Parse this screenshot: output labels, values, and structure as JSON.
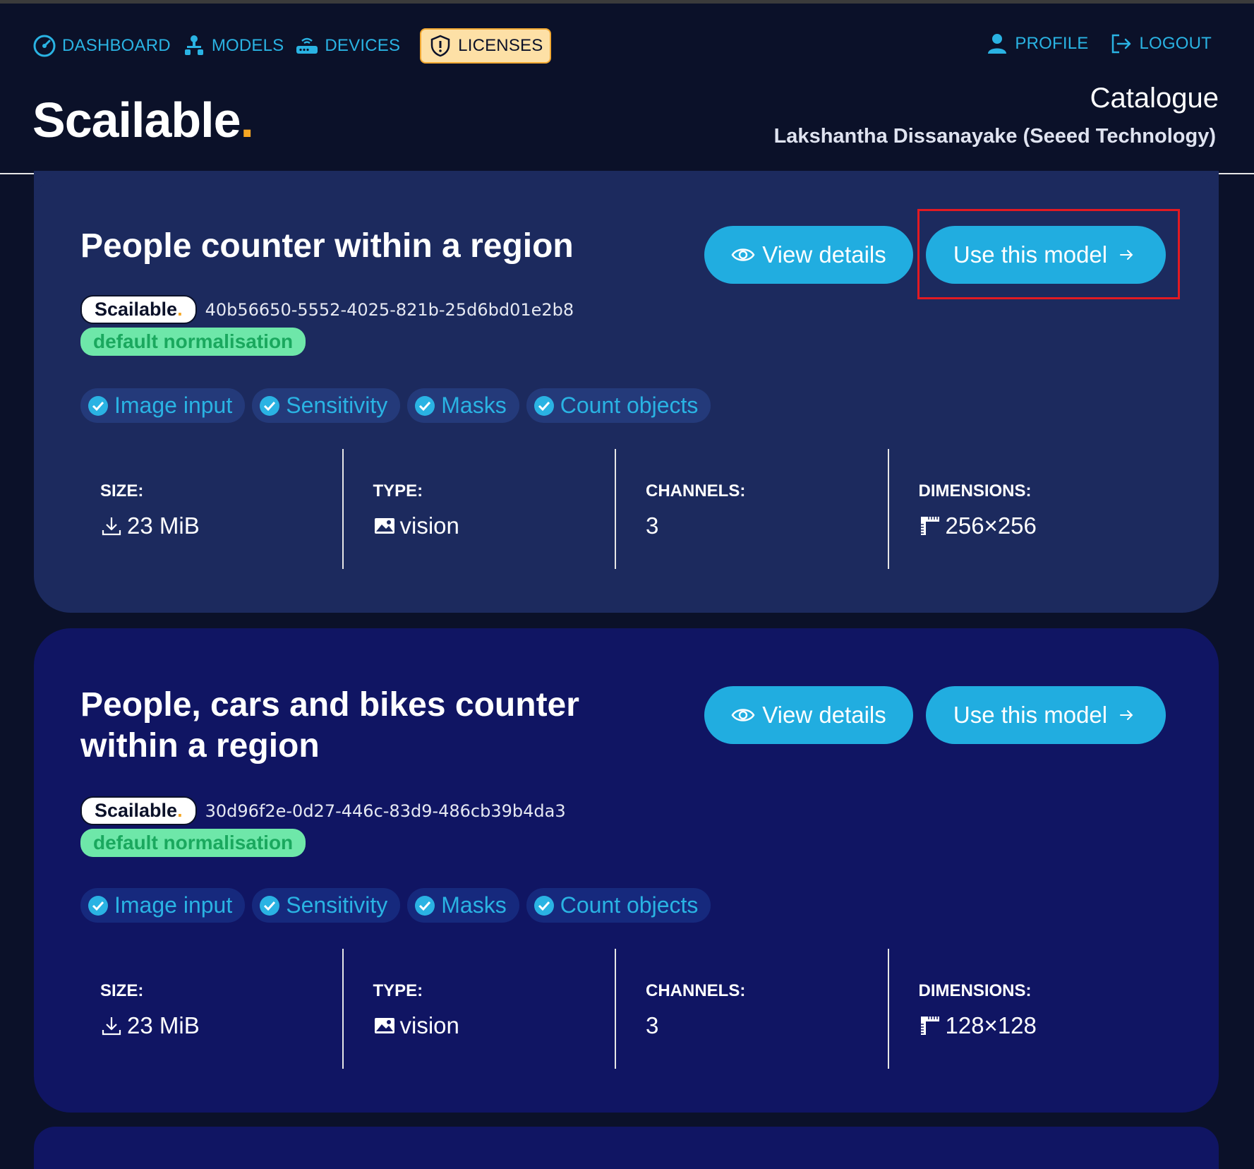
{
  "nav": {
    "items": [
      {
        "label": "DASHBOARD",
        "icon": "gauge-icon"
      },
      {
        "label": "MODELS",
        "icon": "sitemap-icon"
      },
      {
        "label": "DEVICES",
        "icon": "router-icon"
      },
      {
        "label": "LICENSES",
        "icon": "shield-icon",
        "active": true
      }
    ],
    "right": [
      {
        "label": "PROFILE",
        "icon": "user-icon"
      },
      {
        "label": "LOGOUT",
        "icon": "logout-icon"
      }
    ]
  },
  "brand": {
    "name": "Scailable",
    "dot": "."
  },
  "header": {
    "title": "Catalogue",
    "user": "Lakshantha Dissanayake (Seeed Technology)"
  },
  "colors": {
    "accent": "#21ade0",
    "brand_dot": "#f5a623",
    "highlight": "#e21a22",
    "normalisation": "#6ee7a9"
  },
  "models": [
    {
      "title": "People counter within a region",
      "view_label": "View details",
      "use_label": "Use this model",
      "logo_text": "Scailable",
      "uuid": "40b56650-5552-4025-821b-25d6bd01e2b8",
      "normalisation": "default normalisation",
      "features": [
        "Image input",
        "Sensitivity",
        "Masks",
        "Count objects"
      ],
      "specs": {
        "size_label": "SIZE:",
        "size": "23 MiB",
        "type_label": "TYPE:",
        "type": "vision",
        "channels_label": "CHANNELS:",
        "channels": "3",
        "dimensions_label": "DIMENSIONS:",
        "dimensions": "256×256"
      }
    },
    {
      "title": "People, cars and bikes counter within a region",
      "view_label": "View details",
      "use_label": "Use this model",
      "logo_text": "Scailable",
      "uuid": "30d96f2e-0d27-446c-83d9-486cb39b4da3",
      "normalisation": "default normalisation",
      "features": [
        "Image input",
        "Sensitivity",
        "Masks",
        "Count objects"
      ],
      "specs": {
        "size_label": "SIZE:",
        "size": "23 MiB",
        "type_label": "TYPE:",
        "type": "vision",
        "channels_label": "CHANNELS:",
        "channels": "3",
        "dimensions_label": "DIMENSIONS:",
        "dimensions": "128×128"
      }
    }
  ]
}
